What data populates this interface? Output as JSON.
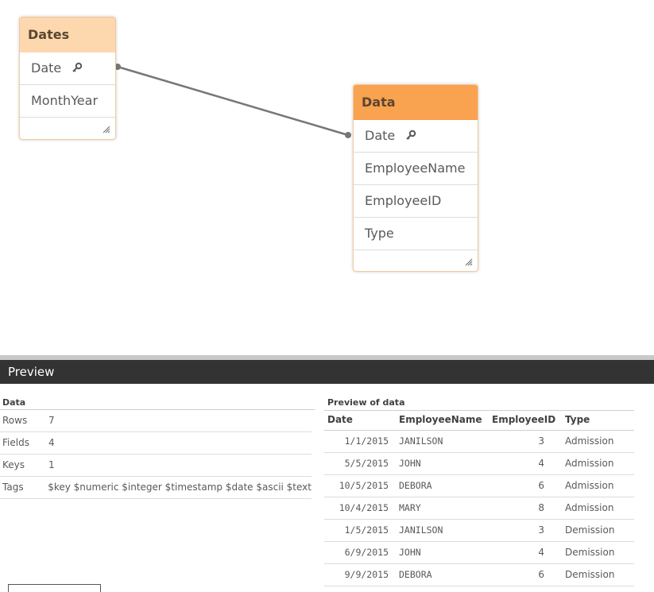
{
  "model": {
    "tables": [
      {
        "name": "Dates",
        "fields": [
          {
            "label": "Date",
            "key": true
          },
          {
            "label": "MonthYear",
            "key": false
          }
        ]
      },
      {
        "name": "Data",
        "fields": [
          {
            "label": "Date",
            "key": true
          },
          {
            "label": "EmployeeName",
            "key": false
          },
          {
            "label": "EmployeeID",
            "key": false
          },
          {
            "label": "Type",
            "key": false
          }
        ]
      }
    ],
    "colors": {
      "dates_header": "#fdd7ad",
      "data_header": "#f9a24f",
      "link": "#777777"
    }
  },
  "preview": {
    "title": "Preview",
    "meta": {
      "title": "Data",
      "rows": [
        {
          "label": "Rows",
          "value": "7"
        },
        {
          "label": "Fields",
          "value": "4"
        },
        {
          "label": "Keys",
          "value": "1"
        },
        {
          "label": "Tags",
          "value": "$key $numeric $integer $timestamp $date $ascii $text"
        }
      ]
    },
    "data_preview": {
      "title": "Preview of data",
      "columns": [
        "Date",
        "EmployeeName",
        "EmployeeID",
        "Type"
      ],
      "rows": [
        [
          "1/1/2015",
          "JANILSON",
          "3",
          "Admission"
        ],
        [
          "5/5/2015",
          "JOHN",
          "4",
          "Admission"
        ],
        [
          "10/5/2015",
          "DEBORA",
          "6",
          "Admission"
        ],
        [
          "10/4/2015",
          "MARY",
          "8",
          "Admission"
        ],
        [
          "1/5/2015",
          "JANILSON",
          "3",
          "Demission"
        ],
        [
          "6/9/2015",
          "JOHN",
          "4",
          "Demission"
        ],
        [
          "9/9/2015",
          "DEBORA",
          "6",
          "Demission"
        ]
      ]
    }
  }
}
